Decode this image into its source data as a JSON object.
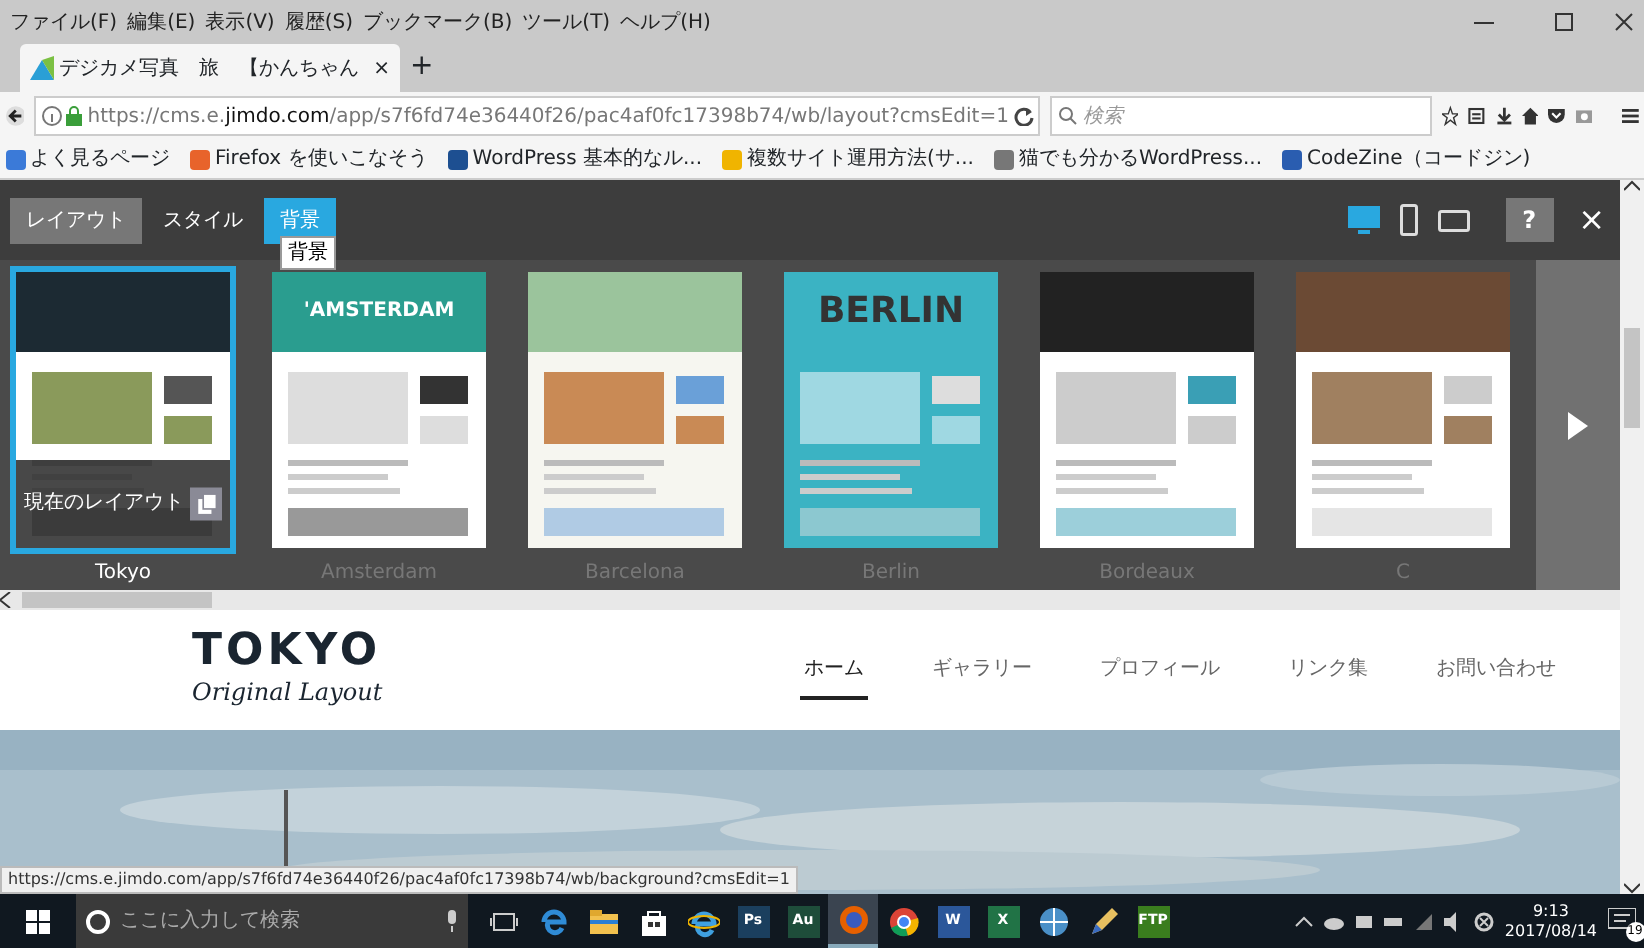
{
  "menu_bar": [
    "ファイル(F)",
    "編集(E)",
    "表示(V)",
    "履歴(S)",
    "ブックマーク(B)",
    "ツール(T)",
    "ヘルプ(H)"
  ],
  "browser_tab": {
    "title": "デジカメ写真　旅　【かんちゃん",
    "close": "×",
    "new_tab": "+"
  },
  "address_bar": {
    "url": "https://cms.e.**jimdo.com**/app/s7f6fd74e36440f26/pac4af0fc17398b74/wb/layout?cmsEdit=1",
    "search_placeholder": "検索"
  },
  "bookmarks": [
    {
      "label": "よく見るページ",
      "color": "#3b7ad8"
    },
    {
      "label": "Firefox を使いこなそう",
      "color": "#e8632b"
    },
    {
      "label": "WordPress 基本的なル...",
      "color": "#1d4f91"
    },
    {
      "label": "複数サイト運用方法(サ...",
      "color": "#f0b400"
    },
    {
      "label": "猫でも分かるWordPress...",
      "color": "#777777"
    },
    {
      "label": "CodeZine（コードジン)",
      "color": "#2a5db0"
    }
  ],
  "editor_tabs": [
    {
      "label": "レイアウト",
      "selected": true,
      "hovered": false
    },
    {
      "label": "スタイル",
      "selected": false,
      "hovered": false
    },
    {
      "label": "背景",
      "selected": false,
      "hovered": true
    }
  ],
  "tooltip": "背景",
  "devices": [
    {
      "kind": "desktop",
      "selected": true
    },
    {
      "kind": "phone",
      "selected": false
    },
    {
      "kind": "tablet",
      "selected": false
    }
  ],
  "help": "?",
  "close": "×",
  "layouts": [
    {
      "name": "Tokyo",
      "selected": true,
      "overlay": "現在のレイアウト"
    },
    {
      "name": "Amsterdam",
      "selected": false,
      "heading": "'AMSTERDAM"
    },
    {
      "name": "Barcelona",
      "selected": false
    },
    {
      "name": "Berlin",
      "selected": false,
      "heading": "BERLIN"
    },
    {
      "name": "Bordeaux",
      "selected": false
    },
    {
      "name": "C",
      "selected": false
    }
  ],
  "site": {
    "logo": "TOKYO",
    "tagline": "Original Layout",
    "nav": [
      {
        "label": "ホーム",
        "selected": true
      },
      {
        "label": "ギャラリー",
        "selected": false
      },
      {
        "label": "プロフィール",
        "selected": false
      },
      {
        "label": "リンク集",
        "selected": false
      },
      {
        "label": "お問い合わせ",
        "selected": false
      }
    ]
  },
  "status_url": "https://cms.e.jimdo.com/app/s7f6fd74e36440f26/pac4af0fc17398b74/wb/background?cmsEdit=1",
  "taskbar": {
    "search_placeholder": "ここに入力して検索",
    "apps": [
      {
        "kind": "edge",
        "active": false
      },
      {
        "kind": "folder",
        "active": false
      },
      {
        "kind": "store",
        "active": false
      },
      {
        "kind": "ie",
        "active": false
      },
      {
        "kind": "tile",
        "label": "Ps",
        "color": "#1b3f5e",
        "active": false
      },
      {
        "kind": "tile",
        "label": "Au",
        "color": "#1e4d3a",
        "active": false
      },
      {
        "kind": "firefox",
        "active": true
      },
      {
        "kind": "chrome",
        "active": false
      },
      {
        "kind": "tile",
        "label": "W",
        "color": "#2b579a",
        "active": false
      },
      {
        "kind": "tile",
        "label": "X",
        "color": "#217346",
        "active": false
      },
      {
        "kind": "globe",
        "active": false
      },
      {
        "kind": "pen",
        "active": false
      },
      {
        "kind": "tile",
        "label": "FTP",
        "color": "#3a7d1e",
        "active": false
      }
    ],
    "time": "9:13",
    "date": "2017/08/14",
    "notifications": "19"
  }
}
